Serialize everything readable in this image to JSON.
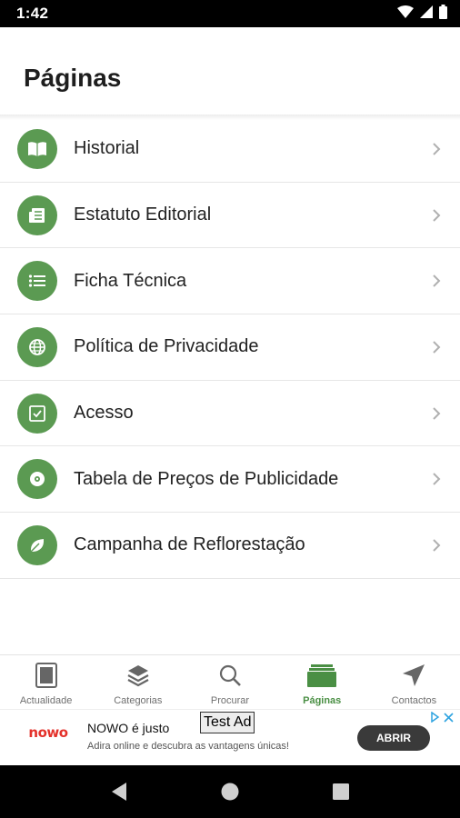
{
  "status_bar": {
    "time": "1:42"
  },
  "header": {
    "title": "Páginas"
  },
  "menu": {
    "items": [
      {
        "label": "Historial",
        "icon": "book-icon"
      },
      {
        "label": "Estatuto Editorial",
        "icon": "newspaper-icon"
      },
      {
        "label": "Ficha Técnica",
        "icon": "list-icon"
      },
      {
        "label": "Política de Privacidade",
        "icon": "globe-icon"
      },
      {
        "label": "Acesso",
        "icon": "checkbox-icon"
      },
      {
        "label": "Tabela de Preços de Publicidade",
        "icon": "disc-icon"
      },
      {
        "label": "Campanha de Reflorestação",
        "icon": "leaf-icon"
      }
    ]
  },
  "bottom_nav": {
    "items": [
      {
        "label": "Actualidade",
        "icon": "newspaper-nav-icon",
        "active": false
      },
      {
        "label": "Categorias",
        "icon": "layers-icon",
        "active": false
      },
      {
        "label": "Procurar",
        "icon": "search-icon",
        "active": false
      },
      {
        "label": "Páginas",
        "icon": "pages-icon",
        "active": true
      },
      {
        "label": "Contactos",
        "icon": "send-icon",
        "active": false
      }
    ]
  },
  "ad": {
    "logo": "nowo",
    "title": "NOWO é justo",
    "subtitle": "Adira online e descubra as vantagens únicas!",
    "tag": "Test Ad",
    "button": "ABRIR"
  },
  "colors": {
    "accent": "#5b9a52",
    "active_nav": "#4a8f44",
    "ad_brand": "#e4322b"
  }
}
